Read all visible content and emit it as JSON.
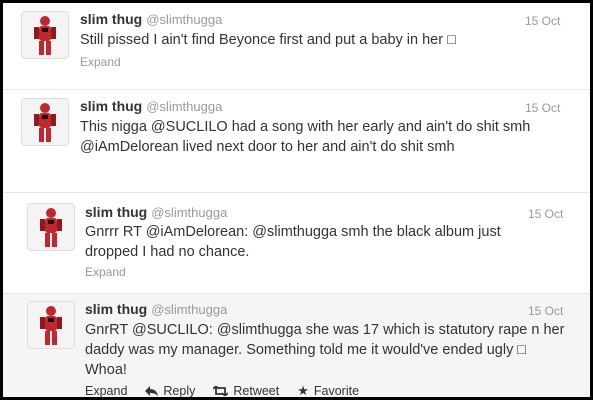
{
  "tweets": [
    {
      "name": "slim thug",
      "handle": "@slimthugga",
      "time": "15 Oct",
      "text": "Still pissed I ain't find Beyonce first and put a baby in her □",
      "expand": "Expand"
    },
    {
      "name": "slim thug",
      "handle": "@slimthugga",
      "time": "15 Oct",
      "text": "This nigga @SUCLILO had a song with her early and ain't do shit smh @iAmDelorean lived next door to her and ain't do shit smh",
      "expand": ""
    },
    {
      "name": "slim thug",
      "handle": "@slimthugga",
      "time": "15 Oct",
      "text": "Gnrrr RT @iAmDelorean: @slimthugga smh the black album just dropped I had no chance.",
      "expand": "Expand"
    },
    {
      "name": "slim thug",
      "handle": "@slimthugga",
      "time": "15 Oct",
      "text": "GnrRT @SUCLILO: @slimthugga she was 17 which is statutory rape n her daddy was my manager. Something told me it would've ended ugly □ Whoa!",
      "expand": "Expand",
      "actions": {
        "reply": "Reply",
        "retweet": "Retweet",
        "favorite": "Favorite"
      }
    }
  ],
  "icons": {
    "reply": "reply-arrow-icon",
    "retweet": "retweet-icon",
    "favorite": "star-icon"
  }
}
